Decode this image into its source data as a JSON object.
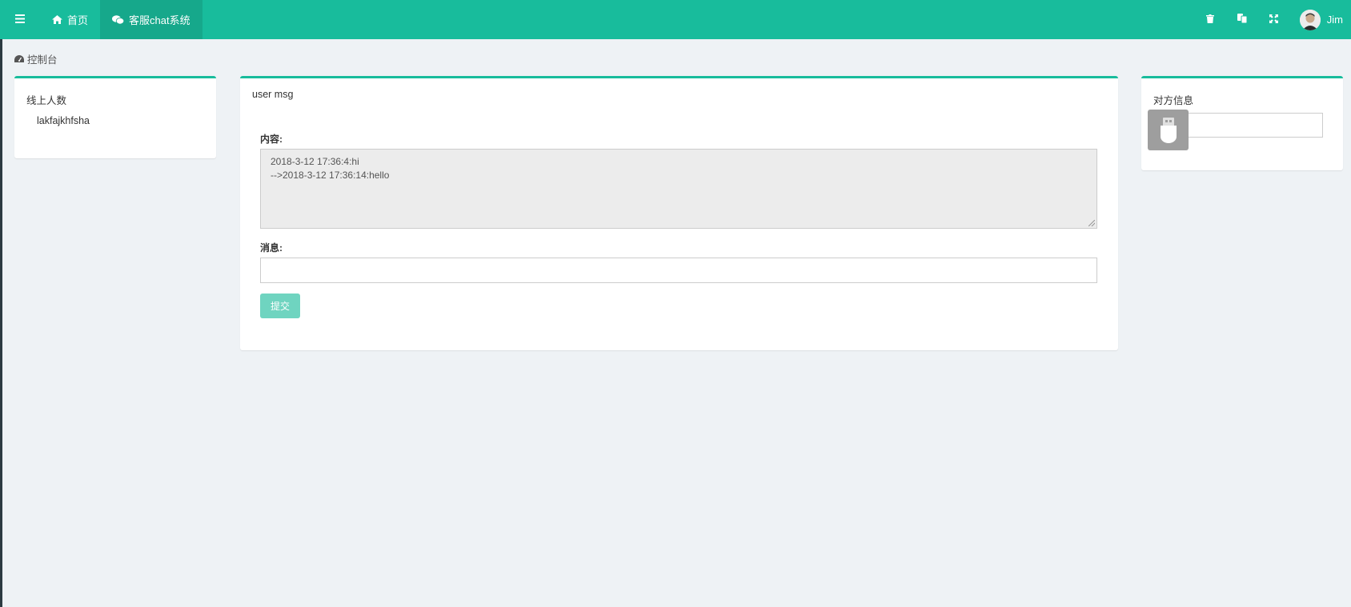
{
  "navbar": {
    "toggle_icon": "bars-icon",
    "home_label": "首页",
    "home_icon": "home-icon",
    "chat_label": "客服chat系统",
    "chat_icon": "wechat-icon",
    "right_icons": [
      "trash-icon",
      "language-icon",
      "expand-icon"
    ],
    "user_name": "Jim",
    "brand_color": "#18bc9c"
  },
  "breadcrumb": {
    "icon": "dashboard-icon",
    "label": "控制台"
  },
  "online_panel": {
    "title": "线上人数",
    "users": [
      "lakfajkhfsha"
    ]
  },
  "chat_panel": {
    "title": "user msg",
    "content_label": "内容:",
    "content_lines": [
      "2018-3-12 17:36:4:hi",
      "-->2018-3-12 17:36:14:hello"
    ],
    "message_label": "消息:",
    "message_value": "",
    "submit_label": "提交"
  },
  "peer_panel": {
    "title": "对方信息",
    "input_value": ""
  }
}
